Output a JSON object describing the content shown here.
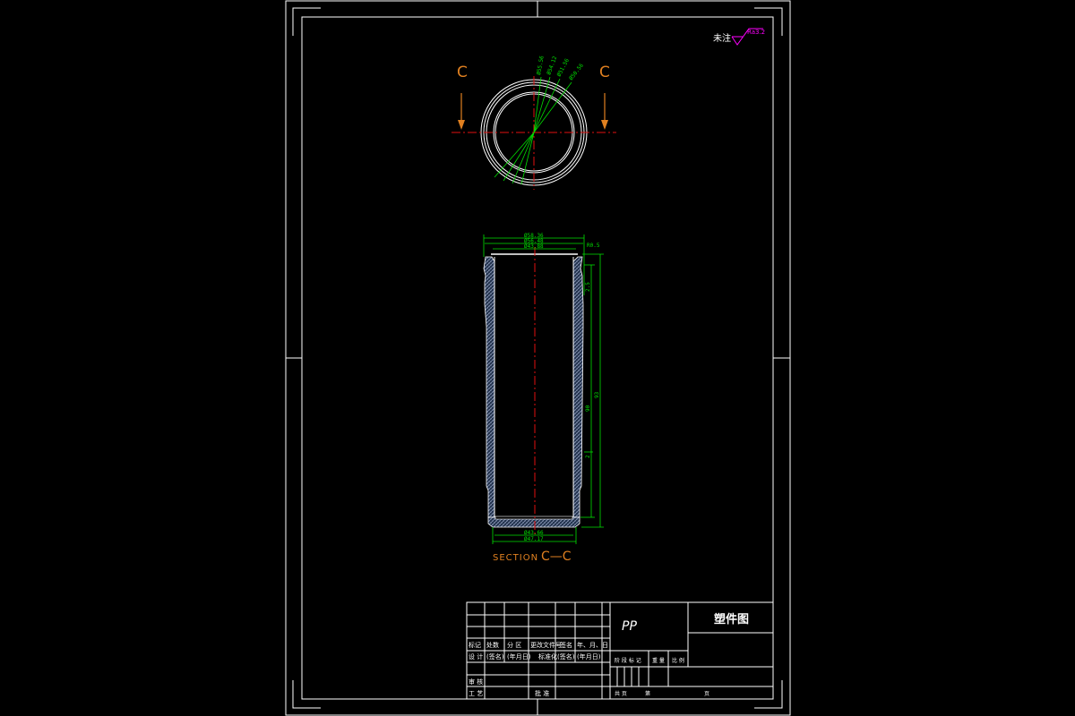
{
  "roughness": {
    "label": "未注",
    "value": "Ra3.2"
  },
  "plan_view": {
    "section_left_letter": "C",
    "section_right_letter": "C",
    "dims": [
      "Ø55.56",
      "Ø54.12",
      "Ø51.56",
      "Ø50.56"
    ]
  },
  "section_view": {
    "caption_prefix": "SECTION",
    "caption_suffix": "C—C",
    "top_dims": [
      "Ø58.36",
      "Ø56.48",
      "Ø43.88"
    ],
    "bottom_dims": [
      "Ø43.66",
      "Ø47.17"
    ],
    "right_dims": [
      "R0.5",
      "2.5",
      "93",
      "90",
      "2"
    ]
  },
  "title_block": {
    "material": "PP",
    "drawing_title": "塑件图",
    "header_labels": [
      "标记",
      "处数",
      "分 区",
      "更改文件号",
      "签名",
      "年、月、日"
    ],
    "row_design": [
      "设 计",
      "(签名)",
      "(年月日)",
      "标准化",
      "(签名)",
      "(年月日)"
    ],
    "row_review": "审 核",
    "row_process": [
      "工 艺",
      "批 准"
    ],
    "stage_labels": [
      "阶 段 标 记",
      "重 量",
      "比 例"
    ],
    "sheet_info": [
      "共 页",
      "第",
      "页"
    ]
  }
}
